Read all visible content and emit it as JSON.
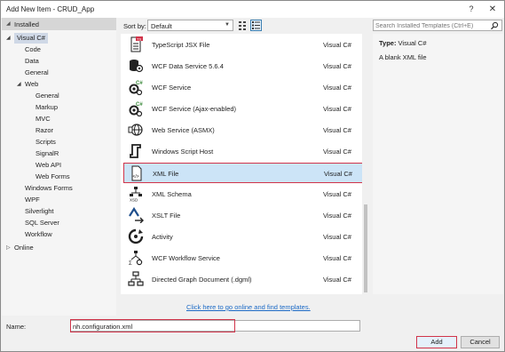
{
  "window": {
    "title": "Add New Item - CRUD_App",
    "help": "?",
    "close": "✕"
  },
  "left": {
    "installed": "Installed",
    "tree": [
      {
        "label": "Visual C#",
        "selected": true
      },
      {
        "label": "Code"
      },
      {
        "label": "Data"
      },
      {
        "label": "General"
      },
      {
        "label": "Web"
      },
      {
        "label": "General"
      },
      {
        "label": "Markup"
      },
      {
        "label": "MVC"
      },
      {
        "label": "Razor"
      },
      {
        "label": "Scripts"
      },
      {
        "label": "SignalR"
      },
      {
        "label": "Web API"
      },
      {
        "label": "Web Forms"
      },
      {
        "label": "Windows Forms"
      },
      {
        "label": "WPF"
      },
      {
        "label": "Silverlight"
      },
      {
        "label": "SQL Server"
      },
      {
        "label": "Workflow"
      }
    ],
    "online": "Online"
  },
  "toolbar": {
    "sort_label": "Sort by:",
    "sort_value": "Default",
    "search_placeholder": "Search Installed Templates (Ctrl+E)"
  },
  "templates": [
    {
      "name": "TypeScript JSX File",
      "lang": "Visual C#",
      "icon": "typescript-jsx-file-icon"
    },
    {
      "name": "WCF Data Service 5.6.4",
      "lang": "Visual C#",
      "icon": "wcf-data-service-icon"
    },
    {
      "name": "WCF Service",
      "lang": "Visual C#",
      "icon": "wcf-service-icon"
    },
    {
      "name": "WCF Service (Ajax-enabled)",
      "lang": "Visual C#",
      "icon": "wcf-service-ajax-icon"
    },
    {
      "name": "Web Service (ASMX)",
      "lang": "Visual C#",
      "icon": "web-service-globe-icon"
    },
    {
      "name": "Windows Script Host",
      "lang": "Visual C#",
      "icon": "script-scroll-icon"
    },
    {
      "name": "XML File",
      "lang": "Visual C#",
      "icon": "xml-file-icon",
      "selected": true
    },
    {
      "name": "XML Schema",
      "lang": "Visual C#",
      "icon": "xml-schema-icon"
    },
    {
      "name": "XSLT File",
      "lang": "Visual C#",
      "icon": "xslt-file-icon"
    },
    {
      "name": "Activity",
      "lang": "Visual C#",
      "icon": "activity-icon"
    },
    {
      "name": "WCF Workflow Service",
      "lang": "Visual C#",
      "icon": "wcf-workflow-icon"
    },
    {
      "name": "Directed Graph Document (.dgml)",
      "lang": "Visual C#",
      "icon": "directed-graph-icon"
    }
  ],
  "online_link": "Click here to go online and find templates.",
  "info": {
    "type_label": "Type:",
    "type_value": "Visual C#",
    "description": "A blank XML file"
  },
  "name_field": {
    "label": "Name:",
    "value": "nh.configuration.xml"
  },
  "buttons": {
    "add": "Add",
    "cancel": "Cancel"
  },
  "colors": {
    "selection_border": "#d1344a",
    "selection_fill": "#cce4f7",
    "link": "#1e6bc6"
  }
}
